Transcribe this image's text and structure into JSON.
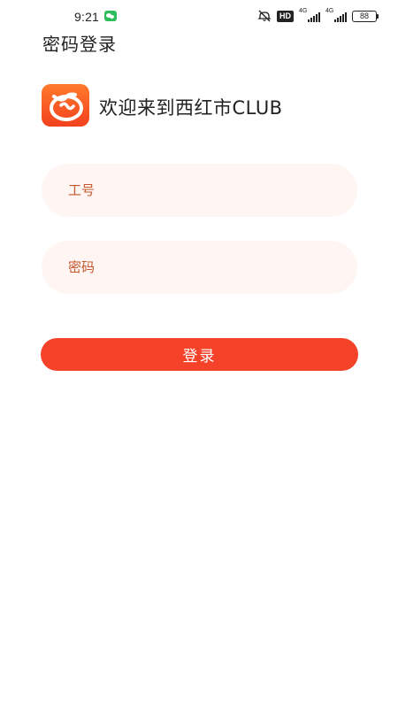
{
  "status_bar": {
    "time": "9:21",
    "hd_label": "HD",
    "network_1": "4G",
    "network_2": "4G",
    "battery": "88"
  },
  "header": {
    "title": "密码登录"
  },
  "brand": {
    "welcome": "欢迎来到西红市CLUB",
    "accent_color": "#f5432a"
  },
  "form": {
    "employee_id": {
      "value": "",
      "placeholder": "工号"
    },
    "password": {
      "value": "",
      "placeholder": "密码"
    },
    "submit_label": "登录"
  },
  "icons": {
    "chat_app": "wechat-icon",
    "mute": "mute-icon",
    "logo": "tomato-logo-icon"
  }
}
